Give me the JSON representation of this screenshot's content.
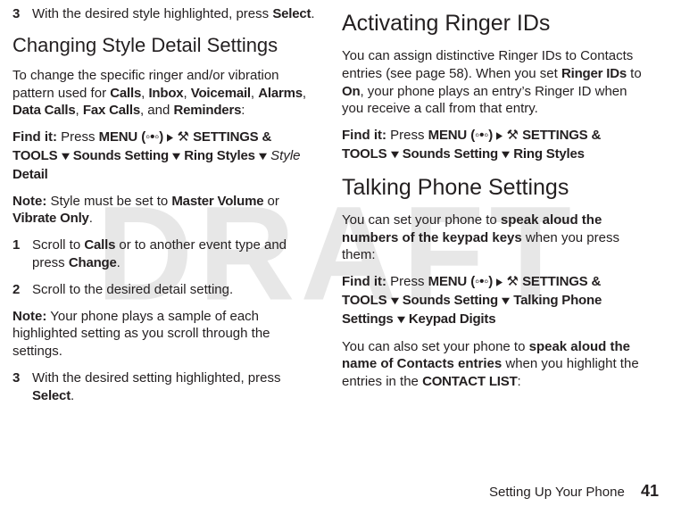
{
  "watermark": "DRAFT",
  "footer": {
    "label": "Setting Up Your Phone",
    "page": "41"
  },
  "left": {
    "step3a": {
      "num": "3",
      "pre": "With the desired style highlighted, press ",
      "select": "Select",
      "post": "."
    },
    "h2": "Changing Style Detail Settings",
    "intro": {
      "pre": "To change the specific ringer and/or vibration pattern used for ",
      "i1": "Calls",
      "c1": ", ",
      "i2": "Inbox",
      "c2": ", ",
      "i3": "Voicemail",
      "c3": ", ",
      "i4": "Alarms",
      "c4": ", ",
      "i5": "Data Calls",
      "c5": ", ",
      "i6": "Fax Calls",
      "c6": ", and ",
      "i7": "Reminders",
      "post": ":"
    },
    "find": {
      "label": "Find it:",
      "press": " Press ",
      "menu": "MENU",
      "menukey": "(◦•◦)",
      "settings": "SETTINGS & TOOLS",
      "sounds": "Sounds Setting",
      "ring": "Ring Styles",
      "style": "Style",
      "detail": " Detail"
    },
    "note1": {
      "label": "Note:",
      "mid": " Style must be set to ",
      "m": "Master Volume",
      "or": " or ",
      "v": "Vibrate Only",
      "end": "."
    },
    "step1": {
      "num": "1",
      "pre": "Scroll to ",
      "calls": "Calls",
      "mid": " or to another event type and press ",
      "change": "Change",
      "post": "."
    },
    "step2": {
      "num": "2",
      "body": "Scroll to the desired detail setting."
    },
    "note2": {
      "label": "Note:",
      "body": " Your phone plays a sample of each highlighted setting as you scroll through the settings."
    },
    "step3b": {
      "num": "3",
      "pre": "With the desired setting highlighted, press ",
      "select": "Select",
      "post": "."
    }
  },
  "right": {
    "h1a": "Activating Ringer IDs",
    "p1": {
      "pre": "You can assign distinctive Ringer IDs to Contacts entries (see page 58). When you set ",
      "rid": "Ringer IDs",
      "to": " to ",
      "on": "On",
      "post": ", your phone plays an entry’s Ringer ID when you receive a call from that entry."
    },
    "find1": {
      "label": "Find it:",
      "press": " Press ",
      "menu": "MENU",
      "menukey": "(◦•◦)",
      "settings": "SETTINGS & TOOLS",
      "sounds": "Sounds Setting",
      "ring": "Ring Styles"
    },
    "h1b": "Talking Phone Settings",
    "p2": {
      "pre": "You can set your phone to ",
      "b": "speak aloud the numbers of the keypad keys",
      "post": " when you press them:"
    },
    "find2": {
      "label": "Find it:",
      "press": " Press ",
      "menu": "MENU",
      "menukey": "(◦•◦)",
      "settings": "SETTINGS & TOOLS",
      "sounds": "Sounds Setting",
      "talking": "Talking Phone Settings",
      "kp": "Keypad Digits"
    },
    "p3": {
      "pre": "You can also set your phone to ",
      "b": "speak aloud the name of Contacts entries",
      "mid": " when you highlight the entries in the ",
      "cl": "CONTACT LIST",
      "post": ":"
    }
  }
}
